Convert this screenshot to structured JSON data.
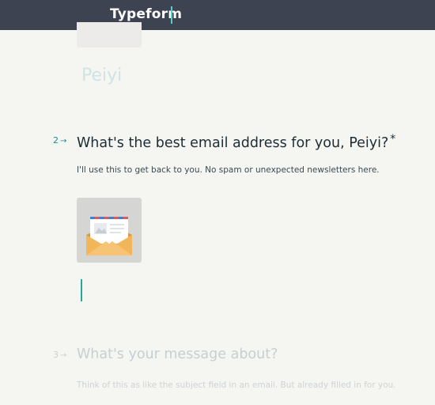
{
  "header": {
    "brand": "Typeform"
  },
  "previous_question": {
    "answer": "Peiyi"
  },
  "question_2": {
    "number": "2",
    "arrow": "→",
    "title": "What's the best email address for you, Peiyi?",
    "required_mark": "*",
    "description": "I'll use this to get back to you. No spam or unexpected newsletters here.",
    "illustration": "envelope-with-letter-icon"
  },
  "question_3": {
    "number": "3",
    "arrow": "→",
    "title": "What's your message about?",
    "description": "Think of this as like the subject field in an email. But already filled in for you."
  },
  "colors": {
    "topbar": "#3d4350",
    "accent": "#1c8c8c",
    "cursor": "#26a69a",
    "faded_text": "#c9cfd1",
    "page_background": "#f5f5f2"
  }
}
